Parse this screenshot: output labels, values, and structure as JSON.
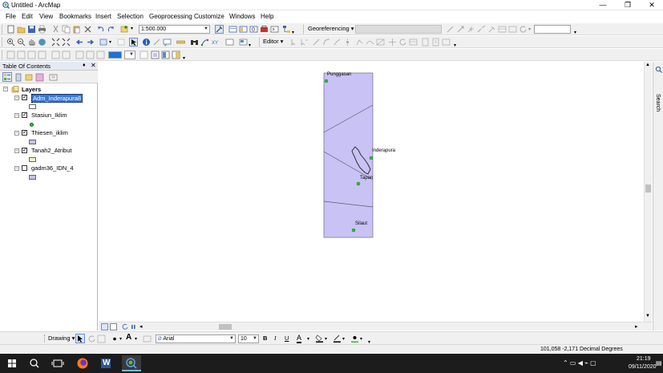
{
  "window": {
    "title": "Untitled - ArcMap",
    "minimize": "—",
    "maximize": "❐",
    "close": "✕"
  },
  "menu": [
    "File",
    "Edit",
    "View",
    "Bookmarks",
    "Insert",
    "Selection",
    "Geoprocessing",
    "Customize",
    "Windows",
    "Help"
  ],
  "toolbar": {
    "scale_value": "1:500.000",
    "georeferencing_label": "Georeferencing",
    "editor_label": "Editor"
  },
  "toc": {
    "title": "Table Of Contents",
    "pin": "♦",
    "close": "✕",
    "root_label": "Layers",
    "layers": [
      {
        "name": "Adm_Inderapura8",
        "checked": true,
        "selected": true,
        "symbol": "#ffffff",
        "symbol_type": "polygon"
      },
      {
        "name": "Stasiun_Iklim",
        "checked": true,
        "selected": false,
        "symbol": "#2fbf3a",
        "symbol_type": "point"
      },
      {
        "name": "Thiesen_iklim",
        "checked": true,
        "selected": false,
        "symbol": "#c8bff2",
        "symbol_type": "polygon"
      },
      {
        "name": "Tanah2_Atribut",
        "checked": true,
        "selected": false,
        "symbol": "#f3f5c0",
        "symbol_type": "polygon"
      },
      {
        "name": "gadm36_IDN_4",
        "checked": false,
        "selected": false,
        "symbol": "#c8bff2",
        "symbol_type": "polygon"
      }
    ]
  },
  "map": {
    "polygon_fill": "#c9c2f4",
    "labels": [
      "Punggasan",
      "Inderapura",
      "Tapan",
      "Silaut"
    ]
  },
  "search_tab": "Search",
  "drawing": {
    "label": "Drawing",
    "font": "Arial",
    "size": "10",
    "bold": "B",
    "italic": "I",
    "underline": "U",
    "text_tool": "A"
  },
  "status": {
    "coordinates": "101,058  -2,171 Decimal Degrees"
  },
  "taskbar": {
    "time": "21:19",
    "date": "09/11/2020",
    "word_letter": "W"
  }
}
